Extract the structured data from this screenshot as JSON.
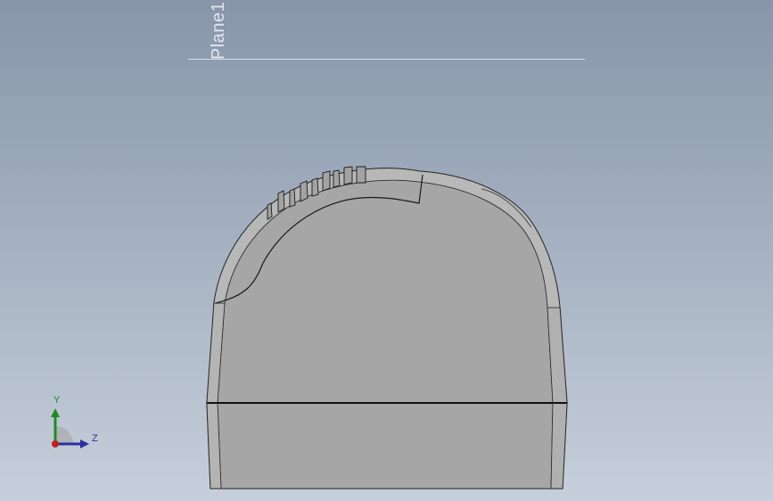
{
  "viewport": {
    "background_top": "#8796aa",
    "background_bottom": "#c6cfdb"
  },
  "plane": {
    "label": "Plane1"
  },
  "model": {
    "face_color": "#a9a9a9",
    "edge_color": "#1a1a1a"
  },
  "triad": {
    "y_label": "Y",
    "z_label": "Z",
    "y_color": "#1f8a1f",
    "z_color": "#2a2f9a",
    "x_color": "#c0201f"
  }
}
